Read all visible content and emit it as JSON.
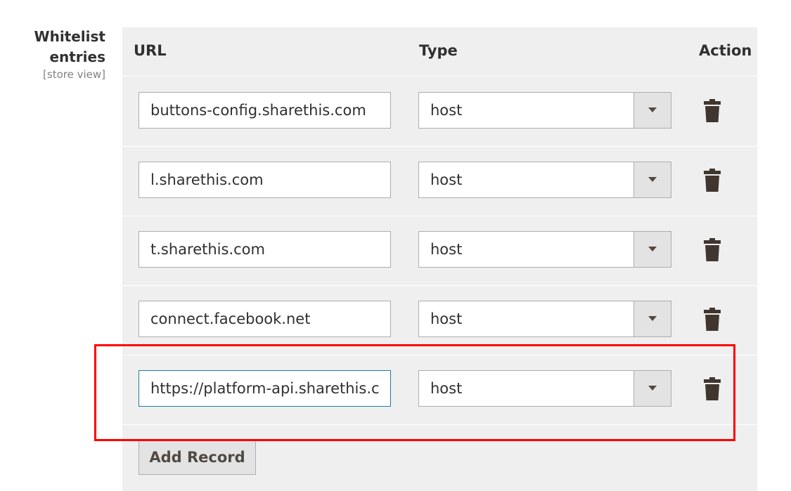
{
  "field": {
    "label_line1": "Whitelist",
    "label_line2": "entries",
    "scope": "[store view]"
  },
  "table": {
    "headers": {
      "url": "URL",
      "type": "Type",
      "action": "Action"
    },
    "rows": [
      {
        "url": "buttons-config.sharethis.com",
        "type": "host"
      },
      {
        "url": "l.sharethis.com",
        "type": "host"
      },
      {
        "url": "t.sharethis.com",
        "type": "host"
      },
      {
        "url": "connect.facebook.net",
        "type": "host"
      },
      {
        "url": "https://platform-api.sharethis.com",
        "type": "host"
      }
    ],
    "row_icon": "trash-icon",
    "add_label": "Add Record"
  },
  "colors": {
    "grid_background": "#efefef",
    "focus_border": "#1a7d9e",
    "highlight": "#ff0000",
    "button_background": "#e3e3e3"
  }
}
